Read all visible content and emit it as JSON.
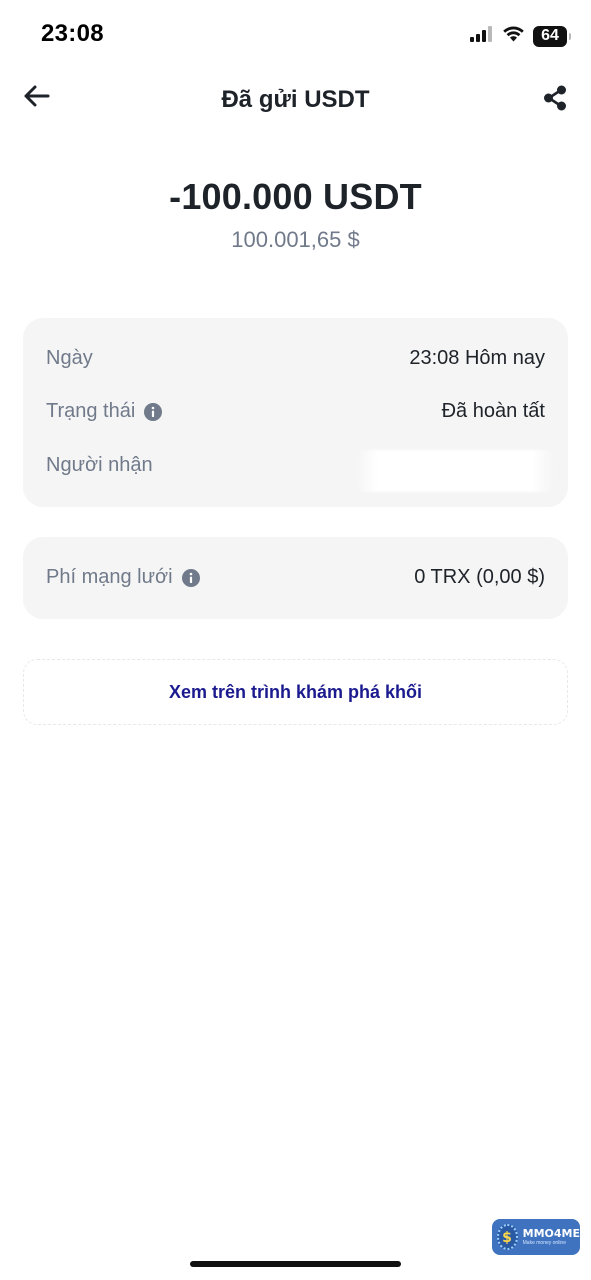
{
  "status_bar": {
    "time": "23:08",
    "battery": "64"
  },
  "header": {
    "title": "Đã gửi USDT",
    "back_icon": "arrow-left-icon",
    "share_icon": "share-icon"
  },
  "amount": {
    "crypto": "-100.000 USDT",
    "fiat": "100.001,65 $"
  },
  "details": {
    "date_label": "Ngày",
    "date_value": "23:08 Hôm nay",
    "status_label": "Trạng thái",
    "status_value": "Đã hoàn tất",
    "recipient_label": "Người nhận"
  },
  "fee": {
    "label": "Phí mạng lưới",
    "value": "0 TRX (0,00 $)"
  },
  "explorer": {
    "label": "Xem trên trình khám phá khối"
  },
  "watermark": {
    "brand": "MMO4ME",
    "tagline": "Make money online"
  },
  "colors": {
    "background": "#ffffff",
    "card": "#f5f5f5",
    "primary_text": "#1e2329",
    "secondary_text": "#707a8a",
    "link": "#1b1b8f"
  }
}
